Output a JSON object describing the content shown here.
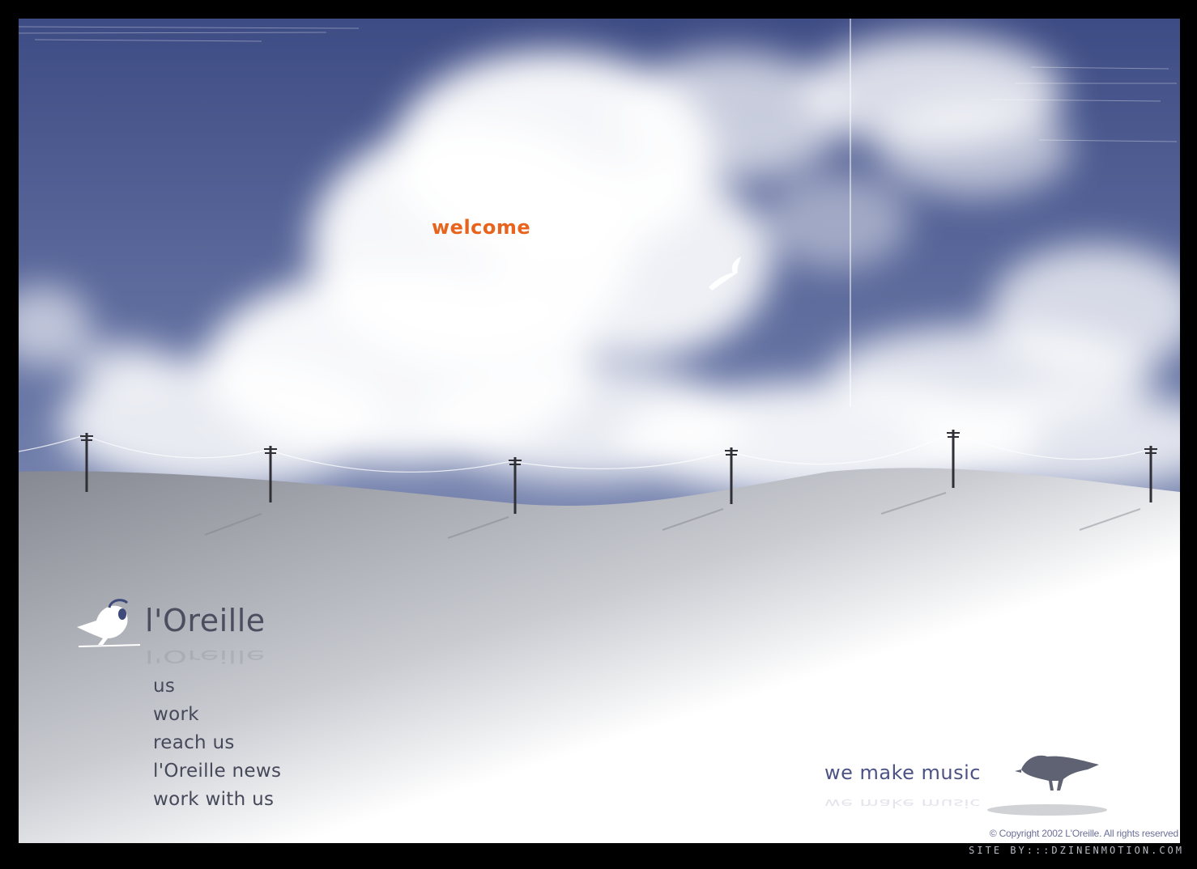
{
  "page": {
    "welcome_label": "welcome",
    "logo_text": "l'Oreille",
    "tagline": "we make music",
    "copyright": "© Copyright 2002 L'Oreille.  All rights reserved",
    "credits": "SITE  BY:::DZINENMOTION.COM"
  },
  "nav": {
    "items": [
      {
        "label": "us"
      },
      {
        "label": "work"
      },
      {
        "label": "reach us"
      },
      {
        "label": "l'Oreille news"
      },
      {
        "label": "work with us"
      }
    ]
  },
  "colors": {
    "frame_bg": "#000000",
    "sky_blue": "#4f5d93",
    "welcome_orange": "#e8641c",
    "nav_text": "#46495a",
    "tagline_blue": "#4c5384",
    "hill_gray": "#8c8f96"
  },
  "icons": [
    "bird-with-headphones-logo-icon",
    "crow-icon",
    "seagull-icon",
    "telephone-pole-icon"
  ]
}
